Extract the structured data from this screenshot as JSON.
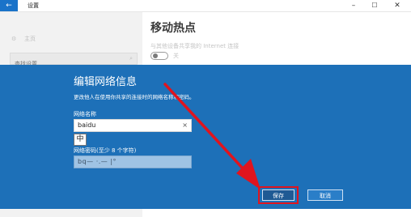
{
  "window": {
    "title": "设置",
    "back_glyph": "←",
    "minimize_glyph": "–",
    "maximize_glyph": "☐",
    "close_glyph": "✕"
  },
  "sidebar": {
    "home_icon": "gear-icon",
    "home_label": "主页",
    "search_placeholder": "查找设置",
    "search_icon": "search-icon"
  },
  "main": {
    "title": "移动热点",
    "description": "与其他设备共享我的 Internet 连接",
    "toggle_state": "关"
  },
  "dialog": {
    "title": "编辑网络信息",
    "description": "更改他人在使用你共享的连接时的网络名称和密码。",
    "name_label": "网络名称",
    "name_value": "baidu",
    "clear_glyph": "×",
    "ime_indicator": "中",
    "password_label": "网络密码(至少 8 个字符)",
    "password_value": "bq— ·.— |°",
    "save_label": "保存",
    "cancel_label": "取消"
  },
  "colors": {
    "dialog_bg": "#1d70b8",
    "highlight": "#e0141e",
    "accent": "#1a73c9"
  }
}
